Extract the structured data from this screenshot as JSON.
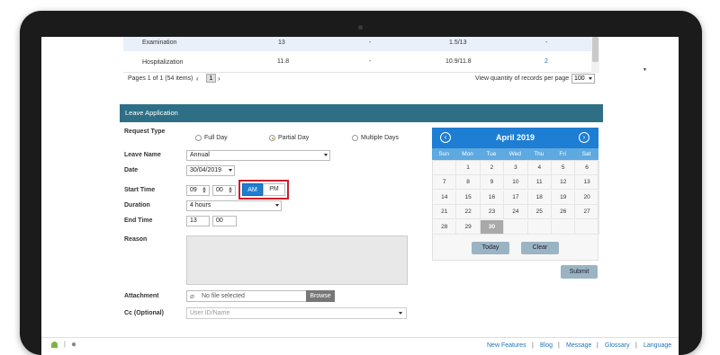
{
  "table": {
    "rows": [
      {
        "name": "Examination",
        "c1": "13",
        "c2": "-",
        "c3": "1.5/13",
        "c4": "-"
      },
      {
        "name": "Hospitalization",
        "c1": "11.8",
        "c2": "-",
        "c3": "10.9/11.8",
        "c4": "2"
      }
    ],
    "pager_text": "Pages 1 of 1 (54 items)",
    "pager_prev": "‹",
    "pager_current": "1",
    "pager_next": "›",
    "records_label": "View quantity of records per page",
    "records_value": "100"
  },
  "leave": {
    "header": "Leave Application",
    "request_type_label": "Request Type",
    "request_types": [
      "Full Day",
      "Partial Day",
      "Multiple Days"
    ],
    "selected_request_type": "Partial Day",
    "leave_name_label": "Leave Name",
    "leave_name_value": "Annual",
    "date_label": "Date",
    "date_value": "30/04/2019",
    "start_time_label": "Start Time",
    "start_hour": "09",
    "start_minute": "00",
    "am_label": "AM",
    "pm_label": "PM",
    "duration_label": "Duration",
    "duration_value": "4 hours",
    "end_time_label": "End Time",
    "end_hour": "13",
    "end_minute": "00",
    "reason_label": "Reason",
    "attachment_label": "Attachment",
    "file_placeholder": "No file selected",
    "browse_label": "Browse",
    "cc_label": "Cc (Optional)",
    "cc_placeholder": "User ID/Name",
    "submit_label": "Submit"
  },
  "calendar": {
    "title": "April 2019",
    "prev_icon": "‹",
    "next_icon": "›",
    "days": [
      "Sun",
      "Mon",
      "Tue",
      "Wed",
      "Thu",
      "Fri",
      "Sat"
    ],
    "weeks": [
      [
        "",
        "1",
        "2",
        "3",
        "4",
        "5",
        "6"
      ],
      [
        "7",
        "8",
        "9",
        "10",
        "11",
        "12",
        "13"
      ],
      [
        "14",
        "15",
        "16",
        "17",
        "18",
        "19",
        "20"
      ],
      [
        "21",
        "22",
        "23",
        "24",
        "25",
        "26",
        "27"
      ],
      [
        "28",
        "29",
        "30",
        "",
        "",
        "",
        ""
      ]
    ],
    "selected_day": "30",
    "today_label": "Today",
    "clear_label": "Clear"
  },
  "footer": {
    "links": [
      "New Features",
      "Blog",
      "Message",
      "Glossary",
      "Language"
    ],
    "separator": "|",
    "android_icon": "android-icon",
    "apple_icon": "apple-icon"
  }
}
